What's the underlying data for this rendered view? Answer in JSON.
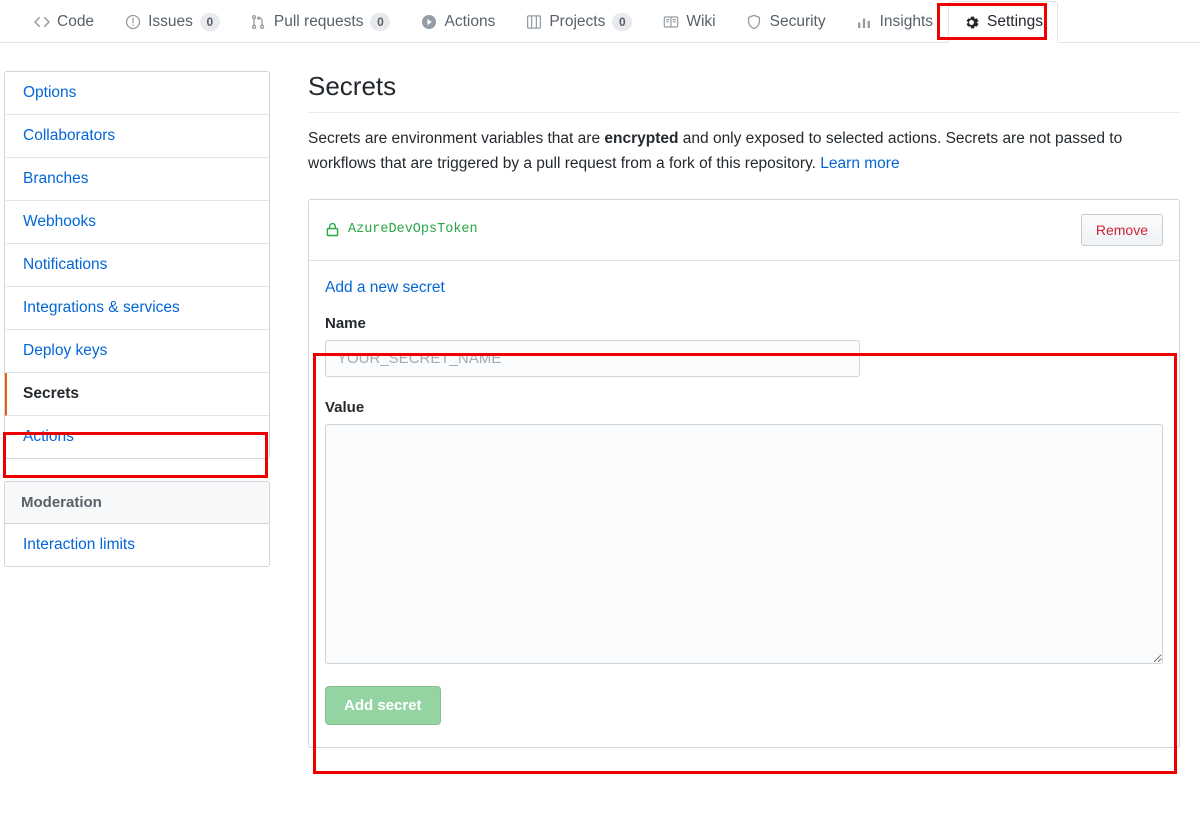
{
  "repo_nav": {
    "tabs": [
      {
        "label": "Code",
        "icon": "code-icon",
        "count": null,
        "selected": false
      },
      {
        "label": "Issues",
        "icon": "issue-icon",
        "count": "0",
        "selected": false
      },
      {
        "label": "Pull requests",
        "icon": "pull-request-icon",
        "count": "0",
        "selected": false
      },
      {
        "label": "Actions",
        "icon": "play-icon",
        "count": null,
        "selected": false
      },
      {
        "label": "Projects",
        "icon": "project-icon",
        "count": "0",
        "selected": false
      },
      {
        "label": "Wiki",
        "icon": "book-icon",
        "count": null,
        "selected": false
      },
      {
        "label": "Security",
        "icon": "shield-icon",
        "count": null,
        "selected": false
      },
      {
        "label": "Insights",
        "icon": "graph-icon",
        "count": null,
        "selected": false
      },
      {
        "label": "Settings",
        "icon": "gear-icon",
        "count": null,
        "selected": true
      }
    ]
  },
  "sidebar": {
    "menus": [
      {
        "heading": null,
        "items": [
          {
            "label": "Options",
            "selected": false
          },
          {
            "label": "Collaborators",
            "selected": false
          },
          {
            "label": "Branches",
            "selected": false
          },
          {
            "label": "Webhooks",
            "selected": false
          },
          {
            "label": "Notifications",
            "selected": false
          },
          {
            "label": "Integrations & services",
            "selected": false
          },
          {
            "label": "Deploy keys",
            "selected": false
          },
          {
            "label": "Secrets",
            "selected": true
          },
          {
            "label": "Actions",
            "selected": false
          }
        ]
      },
      {
        "heading": "Moderation",
        "items": [
          {
            "label": "Interaction limits",
            "selected": false
          }
        ]
      }
    ]
  },
  "main": {
    "title": "Secrets",
    "description": {
      "part1": "Secrets are environment variables that are ",
      "bold": "encrypted",
      "part2": " and only exposed to selected actions. Secrets are not passed to workflows that are triggered by a pull request from a fork of this repository. ",
      "link": "Learn more"
    },
    "existing_secret": {
      "name": "AzureDevOpsToken",
      "icon": "lock-icon",
      "remove_label": "Remove"
    },
    "form": {
      "link_label": "Add a new secret",
      "name_label": "Name",
      "name_value": "",
      "name_placeholder": "YOUR_SECRET_NAME",
      "value_label": "Value",
      "value_value": "",
      "value_placeholder": "",
      "submit_label": "Add secret"
    }
  },
  "annotations": {
    "accent_color": "#ee0000",
    "boxes": [
      "settings-tab",
      "sidebar-secrets",
      "add-secret-form"
    ]
  }
}
